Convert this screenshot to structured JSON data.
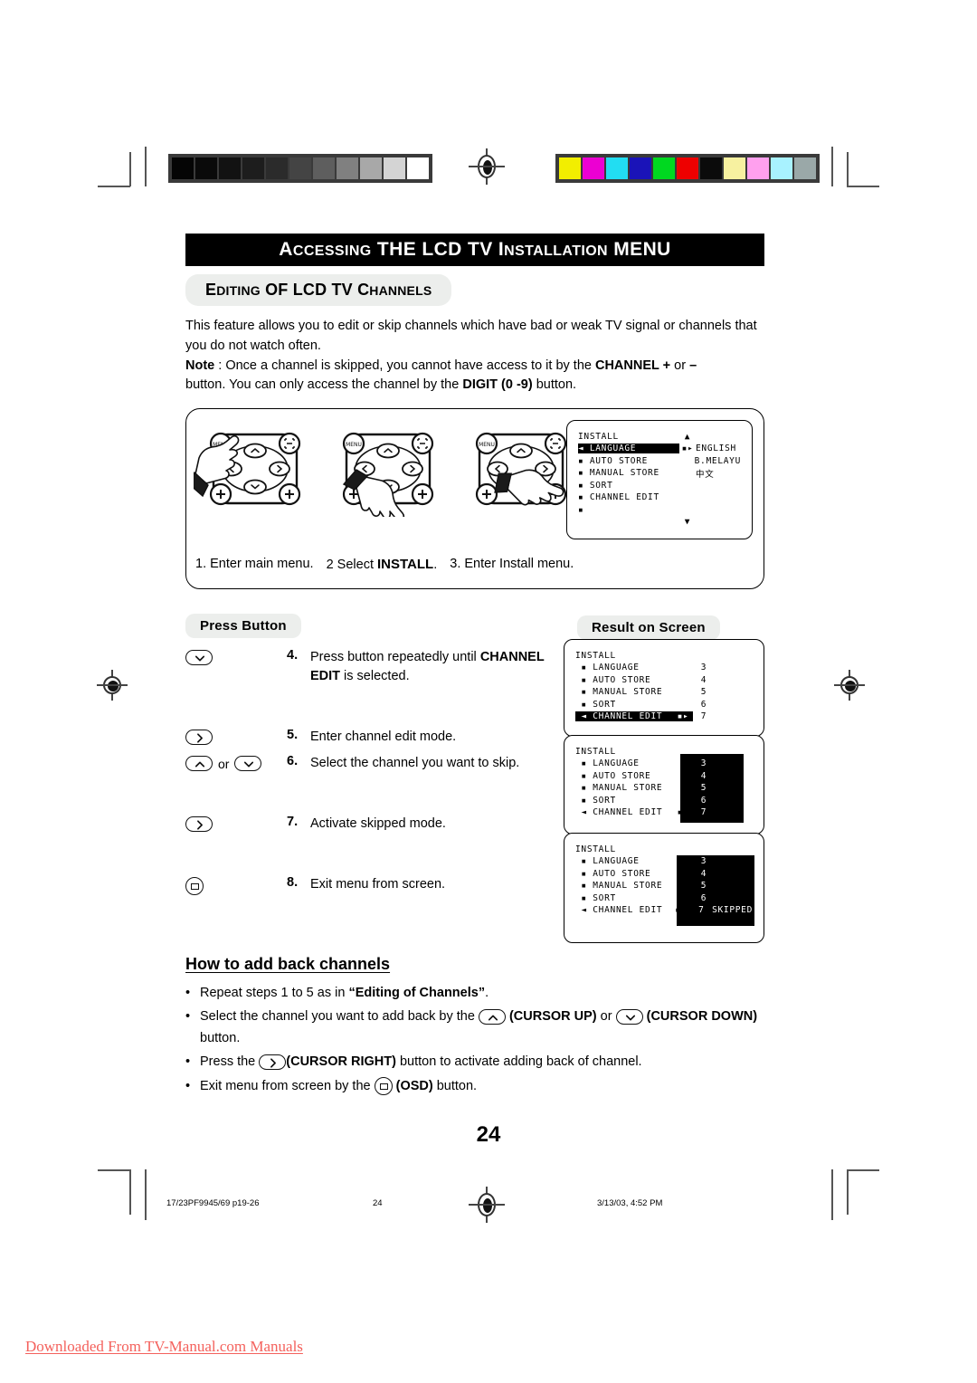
{
  "document": {
    "title": "ACCESSING THE LCD TV INSTALLATION MENU",
    "section_heading": "EDITING OF LCD TV CHANNELS",
    "page_number": "24"
  },
  "intro": {
    "paragraph": "This feature allows you to edit or skip channels which have bad or weak TV signal or channels that you do not watch often.",
    "note_label": "Note",
    "note_line1_a": " : Once a channel is skipped, you cannot have access to it by the ",
    "note_channel": "CHANNEL +",
    "note_line1_b": " or ",
    "note_minus": "–",
    "note_line2_a": "button. You can only access the channel by the ",
    "note_digit": "DIGIT (0 -9)",
    "note_line2_b": " button."
  },
  "panel": {
    "captions": [
      "1. Enter main menu.",
      "2   Select ",
      "3.  Enter Install menu."
    ],
    "caption2_bold": "INSTALL",
    "caption2_tail": ".",
    "osd": {
      "title": "INSTALL",
      "up_arrow": "▲",
      "down_arrow": "▼",
      "rows": [
        {
          "marker": "◄",
          "label": "LANGUAGE",
          "arrows": "▪▸",
          "value": "ENGLISH",
          "highlighted": true
        },
        {
          "marker": "▪",
          "label": "AUTO STORE",
          "arrows": "",
          "value": "B.MELAYU",
          "highlighted": false
        },
        {
          "marker": "▪",
          "label": "MANUAL STORE",
          "arrows": "",
          "value": "中文",
          "highlighted": false
        },
        {
          "marker": "▪",
          "label": "SORT",
          "arrows": "",
          "value": "",
          "highlighted": false
        },
        {
          "marker": "▪",
          "label": "CHANNEL EDIT",
          "arrows": "",
          "value": "",
          "highlighted": false
        },
        {
          "marker": "▪",
          "label": "",
          "arrows": "",
          "value": "",
          "highlighted": false
        }
      ]
    }
  },
  "columns": {
    "press_button": "Press Button",
    "result_on_screen": "Result on Screen"
  },
  "steps": [
    {
      "number": "4.",
      "buttons": [
        "cursor-down"
      ],
      "text_a": "Press button repeatedly until ",
      "text_bold": "CHANNEL EDIT",
      "text_b": " is selected."
    },
    {
      "number": "5.",
      "buttons": [
        "cursor-right"
      ],
      "text_a": "Enter channel edit mode.",
      "text_bold": "",
      "text_b": ""
    },
    {
      "number": "6.",
      "buttons": [
        "cursor-up",
        "or",
        "cursor-down"
      ],
      "or_label": "or",
      "text_a": "Select the channel you want to skip.",
      "text_bold": "",
      "text_b": ""
    },
    {
      "number": "7.",
      "buttons": [
        "cursor-right"
      ],
      "text_a": "Activate skipped mode.",
      "text_bold": "",
      "text_b": ""
    },
    {
      "number": "8.",
      "buttons": [
        "osd"
      ],
      "text_a": "Exit menu from screen.",
      "text_bold": "",
      "text_b": ""
    }
  ],
  "result_screens": [
    {
      "title": "INSTALL",
      "value_panel": false,
      "rows": [
        {
          "marker": "▪",
          "label": "LANGUAGE",
          "arrows": "",
          "num": "3",
          "suffix": "",
          "highlighted": false
        },
        {
          "marker": "▪",
          "label": "AUTO STORE",
          "arrows": "",
          "num": "4",
          "suffix": "",
          "highlighted": false
        },
        {
          "marker": "▪",
          "label": "MANUAL STORE",
          "arrows": "",
          "num": "5",
          "suffix": "",
          "highlighted": false
        },
        {
          "marker": "▪",
          "label": "SORT",
          "arrows": "",
          "num": "6",
          "suffix": "",
          "highlighted": false
        },
        {
          "marker": "◄",
          "label": "CHANNEL EDIT",
          "arrows": "▪▸",
          "num": "7",
          "suffix": "",
          "highlighted": true
        }
      ]
    },
    {
      "title": "INSTALL",
      "value_panel": true,
      "rows": [
        {
          "marker": "▪",
          "label": "LANGUAGE",
          "arrows": "",
          "num": "3",
          "suffix": "",
          "highlighted": false
        },
        {
          "marker": "▪",
          "label": "AUTO STORE",
          "arrows": "",
          "num": "4",
          "suffix": "",
          "highlighted": false
        },
        {
          "marker": "▪",
          "label": "MANUAL STORE",
          "arrows": "",
          "num": "5",
          "suffix": "",
          "highlighted": false
        },
        {
          "marker": "▪",
          "label": "SORT",
          "arrows": "",
          "num": "6",
          "suffix": "",
          "highlighted": false
        },
        {
          "marker": "◄",
          "label": "CHANNEL EDIT",
          "arrows": "▪▸",
          "num": "7",
          "suffix": "",
          "highlighted": false
        }
      ]
    },
    {
      "title": "INSTALL",
      "value_panel": true,
      "rows": [
        {
          "marker": "▪",
          "label": "LANGUAGE",
          "arrows": "",
          "num": "3",
          "suffix": "",
          "highlighted": false
        },
        {
          "marker": "▪",
          "label": "AUTO STORE",
          "arrows": "",
          "num": "4",
          "suffix": "",
          "highlighted": false
        },
        {
          "marker": "▪",
          "label": "MANUAL STORE",
          "arrows": "",
          "num": "5",
          "suffix": "",
          "highlighted": false
        },
        {
          "marker": "▪",
          "label": "SORT",
          "arrows": "",
          "num": "6",
          "suffix": "",
          "highlighted": false
        },
        {
          "marker": "◄",
          "label": "CHANNEL EDIT",
          "arrows": "▪▸",
          "num": "7",
          "suffix": "SKIPPED",
          "highlighted": false
        }
      ]
    }
  ],
  "add_back": {
    "heading": "How to add back channels",
    "bullets": [
      {
        "parts": [
          {
            "t": "Repeat steps 1 to 5 as in ",
            "bold": false
          },
          {
            "t": "“Editing of Channels”",
            "bold": true
          },
          {
            "t": ".",
            "bold": false
          }
        ]
      },
      {
        "parts": [
          {
            "t": "Select the channel you want to add back by the ",
            "bold": false
          },
          {
            "t": "[cursor-up]",
            "bold": false,
            "icon": "cursor-up"
          },
          {
            "t": " (CURSOR UP)",
            "bold": true
          },
          {
            "t": "  or ",
            "bold": false
          },
          {
            "t": "[cursor-down]",
            "bold": false,
            "icon": "cursor-down"
          },
          {
            "t": " (CURSOR DOWN)",
            "bold": true
          },
          {
            "t": " button.",
            "bold": false
          }
        ]
      },
      {
        "parts": [
          {
            "t": "Press the ",
            "bold": false
          },
          {
            "t": "[cursor-right]",
            "bold": false,
            "icon": "cursor-right"
          },
          {
            "t": "(CURSOR RIGHT)",
            "bold": true
          },
          {
            "t": " button to activate adding back of channel.",
            "bold": false
          }
        ]
      },
      {
        "parts": [
          {
            "t": "Exit menu from screen by the ",
            "bold": false
          },
          {
            "t": "[osd]",
            "bold": false,
            "icon": "osd"
          },
          {
            "t": " (OSD)",
            "bold": true
          },
          {
            "t": " button.",
            "bold": false
          }
        ]
      }
    ]
  },
  "footer": {
    "file_ref": "17/23PF9945/69 p19-26",
    "page": "24",
    "timestamp": "3/13/03, 4:52 PM"
  },
  "watermark": "Downloaded From TV-Manual.com Manuals",
  "calibration": {
    "grayscale": [
      "#050505",
      "#0a0a0a",
      "#121212",
      "#1d1d1d",
      "#2b2b2b",
      "#444444",
      "#5e5e5e",
      "#808080",
      "#a8a8a8",
      "#d4d4d4",
      "#ffffff"
    ],
    "colors": [
      "#f2ee00",
      "#ec00d2",
      "#22ddf2",
      "#1a13b8",
      "#00d820",
      "#ee0000",
      "#0b0b0b",
      "#f7f1a0",
      "#ffa0ee",
      "#a8f2ff",
      "#9aa8a8"
    ]
  },
  "icons": {
    "cursor_up": "chevron-up-icon",
    "cursor_down": "chevron-down-icon",
    "cursor_right": "chevron-right-icon",
    "cursor_left": "chevron-left-icon",
    "osd": "osd-icon",
    "menu": "menu-icon",
    "registration": "registration-mark-icon"
  }
}
